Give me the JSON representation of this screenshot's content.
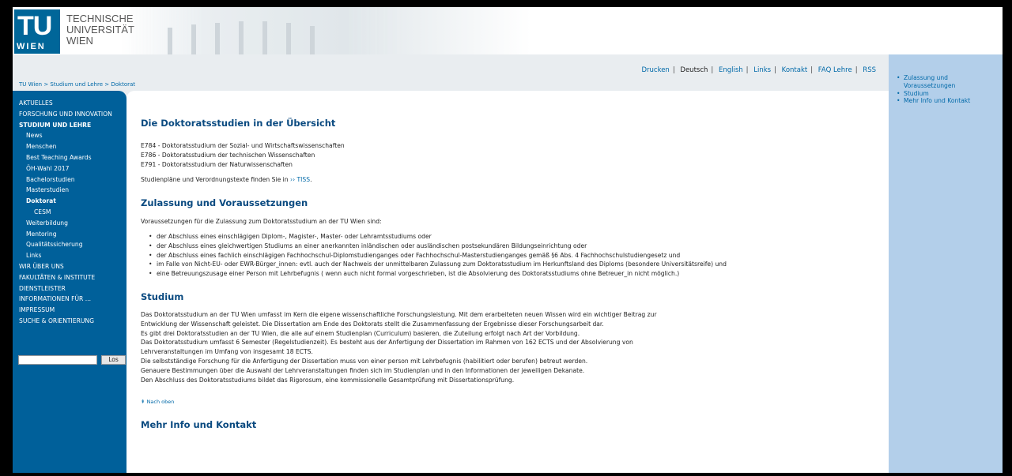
{
  "logo": {
    "tu": "TU",
    "wien": "WIEN",
    "line1": "TECHNISCHE",
    "line2": "UNIVERSITÄT",
    "line3": "WIEN"
  },
  "breadcrumb": [
    "TU Wien",
    "Studium und Lehre",
    "Doktorat"
  ],
  "toplinks": [
    "Drucken",
    "Deutsch",
    "English",
    "Links",
    "Kontakt",
    "FAQ Lehre",
    "RSS"
  ],
  "nav": [
    {
      "label": "AKTUELLES",
      "level": 0,
      "bold": false
    },
    {
      "label": "FORSCHUNG UND INNOVATION",
      "level": 0,
      "bold": false
    },
    {
      "label": "STUDIUM UND LEHRE",
      "level": 0,
      "bold": true
    },
    {
      "label": "News",
      "level": 1,
      "bold": false
    },
    {
      "label": "Menschen",
      "level": 1,
      "bold": false
    },
    {
      "label": "Best Teaching Awards",
      "level": 1,
      "bold": false
    },
    {
      "label": "ÖH-Wahl 2017",
      "level": 1,
      "bold": false
    },
    {
      "label": "Bachelorstudien",
      "level": 1,
      "bold": false
    },
    {
      "label": "Masterstudien",
      "level": 1,
      "bold": false
    },
    {
      "label": "Doktorat",
      "level": 1,
      "bold": true
    },
    {
      "label": "CESM",
      "level": 2,
      "bold": false
    },
    {
      "label": "Weiterbildung",
      "level": 1,
      "bold": false
    },
    {
      "label": "Mentoring",
      "level": 1,
      "bold": false
    },
    {
      "label": "Qualitätssicherung",
      "level": 1,
      "bold": false
    },
    {
      "label": "Links",
      "level": 1,
      "bold": false
    },
    {
      "label": "WIR ÜBER UNS",
      "level": 0,
      "bold": false
    },
    {
      "label": "FAKULTÄTEN & INSTITUTE",
      "level": 0,
      "bold": false
    },
    {
      "label": "DIENSTLEISTER",
      "level": 0,
      "bold": false
    },
    {
      "label": "INFORMATIONEN FÜR ...",
      "level": 0,
      "bold": false
    },
    {
      "label": "IMPRESSUM",
      "level": 0,
      "bold": false
    },
    {
      "label": "SUCHE & ORIENTIERUNG",
      "level": 0,
      "bold": false
    }
  ],
  "search": {
    "button": "Los",
    "value": ""
  },
  "main": {
    "h1": "Die Doktoratsstudien in der Übersicht",
    "programs": [
      "E784 - Doktoratsstudium der Sozial- und Wirtschaftswissenschaften",
      "E786 - Doktoratsstudium der technischen Wissenschaften",
      "E791 - Doktoratsstudium der Naturwissenschaften"
    ],
    "tiss_prefix": "Studienpläne und Verordnungstexte finden Sie in",
    "tiss_link": "TISS",
    "tiss_suffix": ".",
    "h2": "Zulassung und Voraussetzungen",
    "req_intro": "Voraussetzungen für die Zulassung zum Doktoratsstudium an der TU Wien sind:",
    "requirements": [
      "der Abschluss eines einschlägigen Diplom-, Magister-, Master- oder Lehramtsstudiums oder",
      "der Abschluss eines gleichwertigen Studiums an einer anerkannten inländischen oder ausländischen postsekundären Bildungseinrichtung oder",
      "der Abschluss eines fachlich einschlägigen Fachhochschul-Diplomstudienganges oder Fachhochschul-Masterstudienganges gemäß §6 Abs. 4 Fachhochschulstudiengesetz und",
      "im Falle von Nicht-EU- oder EWR-Bürger_innen: evtl. auch der Nachweis der unmittelbaren Zulassung zum Doktoratsstudium im Herkunftsland des Diploms (besondere Universitätsreife) und",
      "eine Betreuungszusage einer Person mit Lehrbefugnis ( wenn auch nicht formal vorgeschrieben, ist die Absolvierung des Doktoratsstudiums ohne Betreuer_in nicht möglich.)"
    ],
    "h3": "Studium",
    "studium_lines": [
      "Das Doktoratsstudium an der TU Wien umfasst im Kern die eigene wissenschaftliche Forschungsleistung. Mit dem erarbeiteten neuen Wissen wird ein wichtiger Beitrag zur",
      "Entwicklung der Wissenschaft geleistet. Die Dissertation am Ende des Doktorats stellt die Zusammenfassung der Ergebnisse dieser Forschungsarbeit dar.",
      "Es gibt drei Doktoratsstudien an der TU Wien, die alle auf einem Studienplan (Curriculum) basieren, die Zuteilung erfolgt nach Art der Vorbildung.",
      "Das Doktoratsstudium umfasst 6 Semester (Regelstudienzeit). Es besteht aus der Anfertigung der Dissertation im Rahmen von 162 ECTS und der Absolvierung von",
      "Lehrveranstaltungen im Umfang von insgesamt 18 ECTS.",
      "Die selbstständige Forschung für die Anfertigung der Dissertation muss von einer person mit Lehrbefugnis (habilitiert oder berufen) betreut werden.",
      "Genauere Bestimmungen über die Auswahl der Lehrveranstaltungen finden sich im Studienplan und in den Informationen der jeweiligen Dekanate.",
      "Den Abschluss des Doktoratsstudiums bildet das Rigorosum, eine kommissionelle Gesamtprüfung mit Dissertationsprüfung."
    ],
    "back_to_top": "Nach oben",
    "h4": "Mehr Info und Kontakt"
  },
  "right_links": [
    "Zulassung und Voraussetzungen",
    "Studium",
    "Mehr Info und Kontakt"
  ],
  "colors": {
    "nav_bg": "#00609a",
    "right_bg": "#b3cfea",
    "heading": "#0a4a80",
    "link": "#0069a8"
  }
}
